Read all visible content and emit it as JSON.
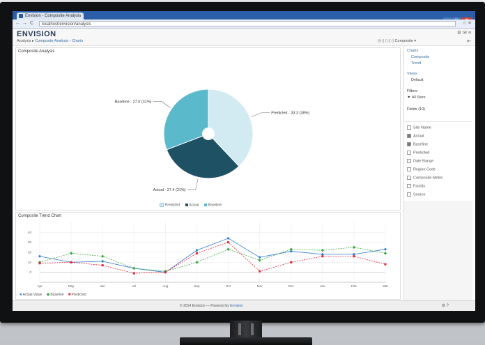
{
  "browser": {
    "tab_title": "Envision - Composite Analysis",
    "url": "localhost/envision/analysis",
    "window_buttons": {
      "minimize": "–",
      "maximize": "□",
      "close": "✕"
    },
    "nav": {
      "back": "←",
      "forward": "→",
      "reload": "C"
    },
    "toolbar_right": "☆ ≡"
  },
  "app": {
    "logo": "ENVISION",
    "header_icons": "⚙ ✉ ≡",
    "breadcrumb": {
      "first": "Analysis ▸",
      "link": "Composite Analysis › Charts"
    },
    "view_controls": "◷ ▯ ▯ ▯  ▯ Composite  ▾",
    "collapse": "⇤"
  },
  "pie_panel": {
    "title": "Composite Analysis",
    "legend": [
      "Predicted",
      "Actual",
      "Baseline"
    ],
    "labels": [
      "Predicted - 33.3 (38%)",
      "Actual - 27.4 (31%)",
      "Baseline - 27.0 (31%)"
    ]
  },
  "line_panel": {
    "title": "Composite Trend Chart",
    "legend": [
      "Actual Value",
      "Baseline",
      "Predicted"
    ]
  },
  "sidebar": {
    "sections": [
      {
        "title": "Charts",
        "items": [
          "Composite",
          "Trend"
        ]
      },
      {
        "title": "Views",
        "items": [
          "Default"
        ]
      },
      {
        "title": "Filters",
        "items": [
          "▼ All Sites"
        ]
      }
    ],
    "fields_title": "Fields (10)",
    "fields": [
      {
        "label": "Site Name",
        "checked": false
      },
      {
        "label": "Actual",
        "checked": true
      },
      {
        "label": "Baseline",
        "checked": true
      },
      {
        "label": "Predicted",
        "checked": false
      },
      {
        "label": "Date Range",
        "checked": false
      },
      {
        "label": "Region Code",
        "checked": false
      },
      {
        "label": "Composite Metric",
        "checked": false
      },
      {
        "label": "Facility",
        "checked": false
      },
      {
        "label": "Source",
        "checked": false
      }
    ]
  },
  "footer": {
    "text_prefix": "© 2014 Envision — Powered by ",
    "text_link": "Envision",
    "icons": "⚙ ?"
  },
  "colors": {
    "frame": "#101112",
    "chrome": "#2c5ea8",
    "pie_light": "#d2ebf3",
    "pie_dark": "#1f5164",
    "pie_mid": "#5ab9cb",
    "series_actual": "#2f7bd1",
    "series_baseline": "#3fa845",
    "series_predicted": "#e0263b"
  },
  "chart_data": [
    {
      "type": "pie",
      "title": "Composite Analysis",
      "categories": [
        "Predicted",
        "Actual",
        "Baseline"
      ],
      "values": [
        33.3,
        27.4,
        27.0
      ],
      "legend": "bottom"
    },
    {
      "type": "line",
      "title": "Composite Trend Chart",
      "categories": [
        "Apr",
        "May",
        "Jun",
        "Jul",
        "Aug",
        "Sep",
        "Oct",
        "Nov",
        "Dec",
        "Jan",
        "Feb",
        "Mar"
      ],
      "ylim": [
        -10,
        50
      ],
      "yticks": [
        0,
        10,
        20,
        30,
        40
      ],
      "series": [
        {
          "name": "Actual Value",
          "values": [
            16,
            10,
            11,
            4,
            0,
            22,
            34,
            15,
            21,
            18,
            18,
            23
          ]
        },
        {
          "name": "Baseline",
          "values": [
            10,
            19,
            16,
            4,
            1,
            10,
            23,
            12,
            23,
            22,
            25,
            19
          ]
        },
        {
          "name": "Predicted",
          "values": [
            9,
            10,
            7,
            -1,
            0,
            19,
            30,
            1,
            10,
            16,
            16,
            8
          ]
        }
      ],
      "legend": "bottom-left",
      "grid": true
    }
  ]
}
